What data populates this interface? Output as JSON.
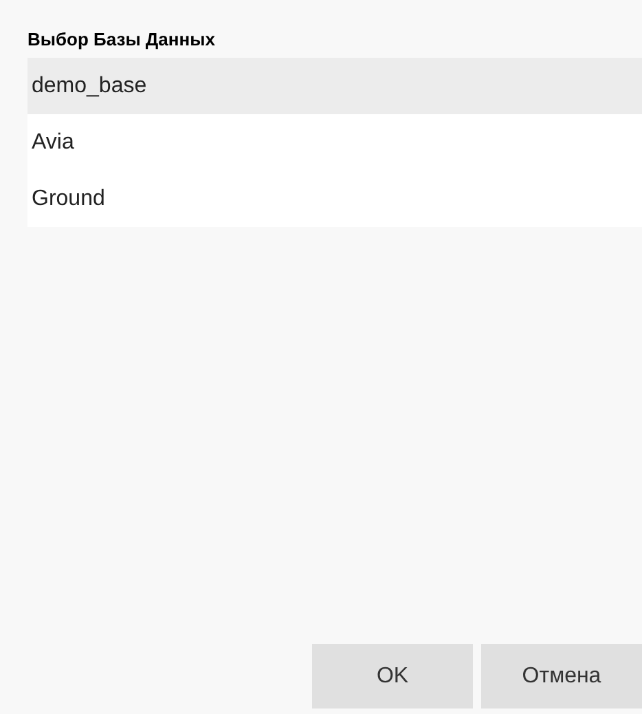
{
  "title": "Выбор Базы Данных",
  "items": [
    {
      "label": "demo_base",
      "selected": true
    },
    {
      "label": "Avia",
      "selected": false
    },
    {
      "label": "Ground",
      "selected": false
    }
  ],
  "buttons": [
    "OK",
    "Отмена"
  ]
}
